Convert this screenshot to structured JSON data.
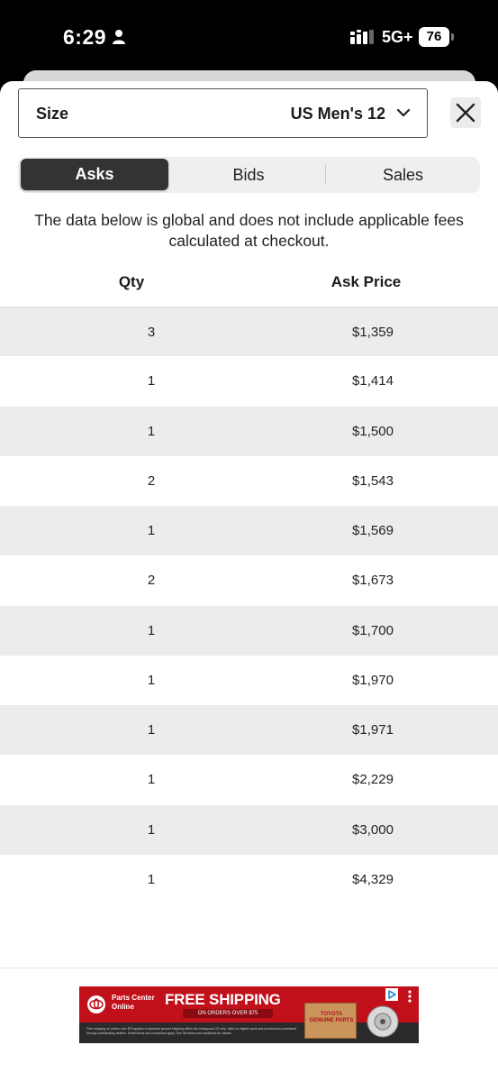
{
  "status_bar": {
    "time": "6:29",
    "network": "5G+",
    "battery": "76"
  },
  "size_selector": {
    "label": "Size",
    "value": "US Men's 12"
  },
  "tabs": [
    {
      "label": "Asks",
      "active": true
    },
    {
      "label": "Bids",
      "active": false
    },
    {
      "label": "Sales",
      "active": false
    }
  ],
  "disclaimer": "The data below is global and does not include applicable fees calculated at checkout.",
  "table": {
    "headers": {
      "qty": "Qty",
      "price": "Ask Price"
    },
    "rows": [
      {
        "qty": "3",
        "price": "$1,359"
      },
      {
        "qty": "1",
        "price": "$1,414"
      },
      {
        "qty": "1",
        "price": "$1,500"
      },
      {
        "qty": "2",
        "price": "$1,543"
      },
      {
        "qty": "1",
        "price": "$1,569"
      },
      {
        "qty": "2",
        "price": "$1,673"
      },
      {
        "qty": "1",
        "price": "$1,700"
      },
      {
        "qty": "1",
        "price": "$1,970"
      },
      {
        "qty": "1",
        "price": "$1,971"
      },
      {
        "qty": "1",
        "price": "$2,229"
      },
      {
        "qty": "1",
        "price": "$3,000"
      },
      {
        "qty": "1",
        "price": "$4,329"
      }
    ]
  },
  "ad": {
    "brand": "Parts Center Online",
    "headline": "FREE SHIPPING",
    "subline": "ON ORDERS OVER $75",
    "box_label": "TOYOTA GENUINE PARTS",
    "fineprint": "Free shipping on orders over $75 applies to standard ground shipping within the contiguous US only. Valid on eligible parts and accessories purchased through participating dealers. Restrictions and exclusions apply. See full terms and conditions for details.",
    "colors": {
      "primary": "#c2101b",
      "strip": "#2a2a2a"
    }
  },
  "colors": {
    "active_tab": "#333333",
    "row_shade": "#ececec"
  },
  "icons": [
    "person-icon",
    "signal-icon",
    "chevron-down-icon",
    "close-icon",
    "toyota-logo-icon",
    "brake-rotor-icon",
    "ad-choices-icon",
    "ad-menu-icon"
  ]
}
